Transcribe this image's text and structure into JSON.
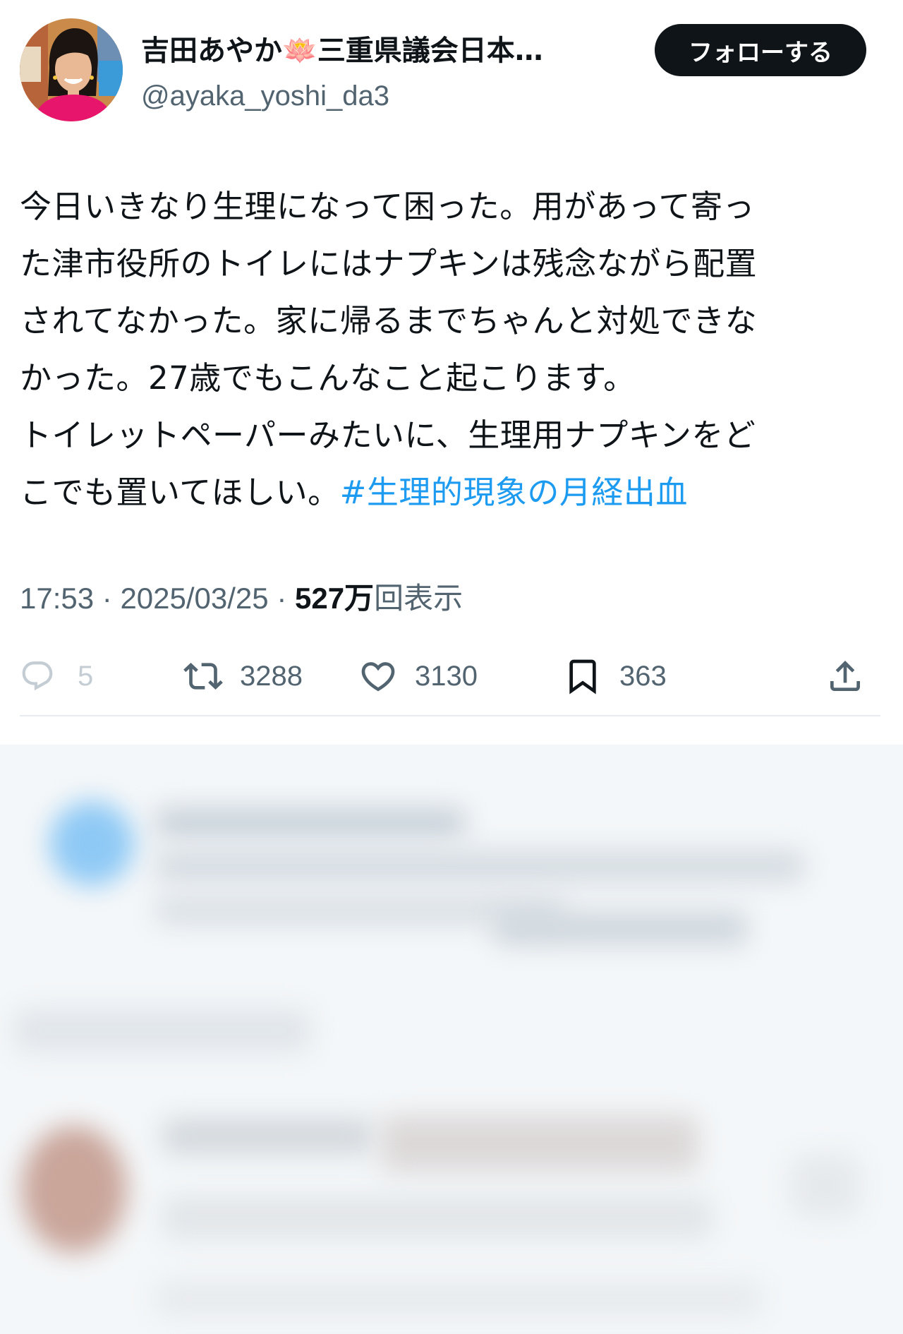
{
  "user": {
    "display_name": "吉田あやか",
    "lotus_emoji": "🪷",
    "display_name_suffix": "三重県議会日本…",
    "handle": "@ayaka_yoshi_da3",
    "follow_label": "フォローする"
  },
  "tweet": {
    "lines": [
      "今日いきなり生理になって困った。用があって寄っ",
      "た津市役所のトイレにはナプキンは残念ながら配置",
      "されてなかった。家に帰るまでちゃんと対処できな",
      "かった。27歳でもこんなこと起こります。",
      "トイレットペーパーみたいに、生理用ナプキンをど"
    ],
    "last_line_text": "こでも置いてほしい。",
    "hashtag": "#生理的現象の月経出血"
  },
  "meta": {
    "time": "17:53",
    "separator": " · ",
    "date": "2025/03/25",
    "views_number": "527万",
    "views_label": "回表示"
  },
  "actions": {
    "reply_count": "5",
    "retweet_count": "3288",
    "like_count": "3130",
    "bookmark_count": "363"
  },
  "icons": {
    "reply": "reply-icon",
    "retweet": "retweet-icon",
    "like": "heart-icon",
    "bookmark": "bookmark-icon",
    "share": "share-icon"
  },
  "colors": {
    "text": "#0f1419",
    "secondary": "#536471",
    "link": "#1d9bf0",
    "follow_bg": "#0f1419",
    "divider": "#e6ecf0"
  }
}
